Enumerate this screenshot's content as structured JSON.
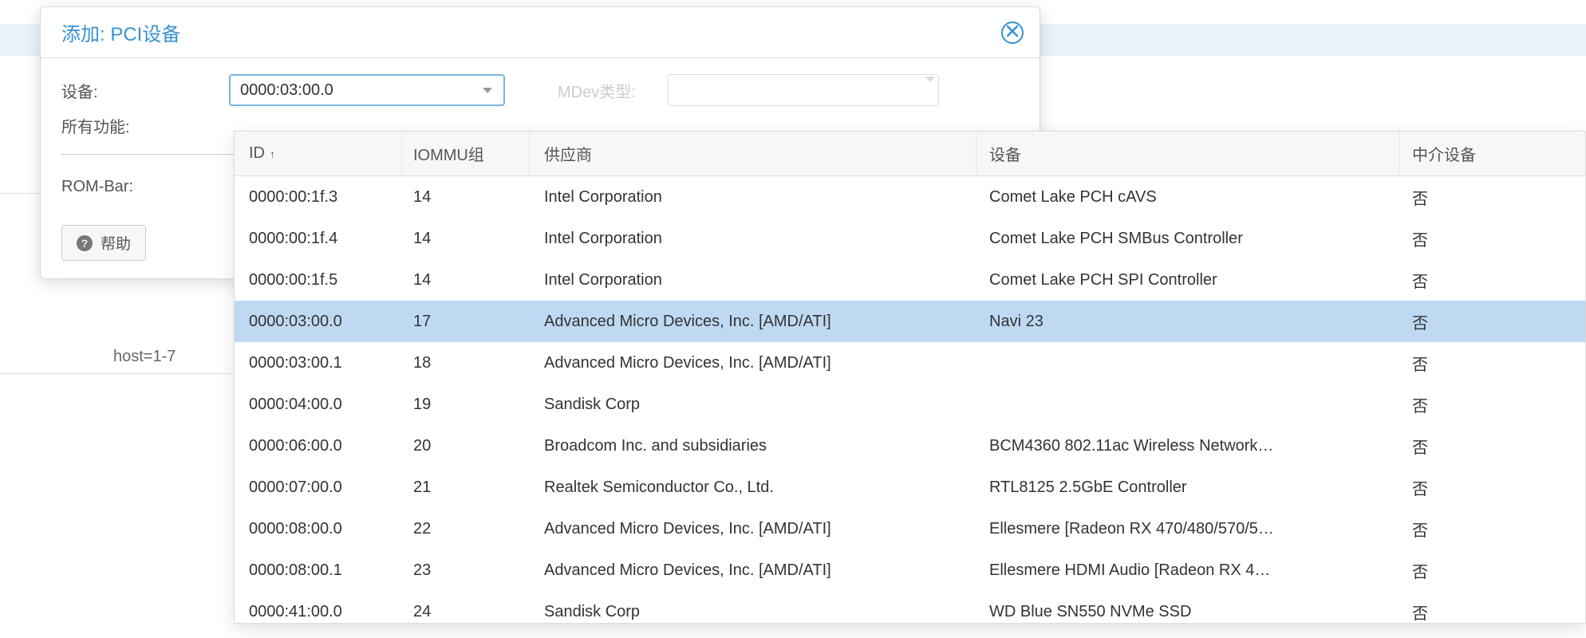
{
  "background": {
    "text1": "host=1-7"
  },
  "dialog": {
    "title": "添加: PCI设备",
    "form": {
      "device_label": "设备:",
      "device_value": "0000:03:00.0",
      "mdev_label": "MDev类型:",
      "all_functions_label": "所有功能:",
      "rom_bar_label": "ROM-Bar:"
    },
    "help_label": "帮助"
  },
  "grid": {
    "headers": {
      "id": "ID",
      "iommu": "IOMMU组",
      "vendor": "供应商",
      "device": "设备",
      "mdev": "中介设备"
    },
    "rows": [
      {
        "id": "0000:00:1f.3",
        "iommu": "14",
        "vendor": "Intel Corporation",
        "device": "Comet Lake PCH cAVS",
        "mdev": "否",
        "selected": false
      },
      {
        "id": "0000:00:1f.4",
        "iommu": "14",
        "vendor": "Intel Corporation",
        "device": "Comet Lake PCH SMBus Controller",
        "mdev": "否",
        "selected": false
      },
      {
        "id": "0000:00:1f.5",
        "iommu": "14",
        "vendor": "Intel Corporation",
        "device": "Comet Lake PCH SPI Controller",
        "mdev": "否",
        "selected": false
      },
      {
        "id": "0000:03:00.0",
        "iommu": "17",
        "vendor": "Advanced Micro Devices, Inc. [AMD/ATI]",
        "device": "Navi 23",
        "mdev": "否",
        "selected": true
      },
      {
        "id": "0000:03:00.1",
        "iommu": "18",
        "vendor": "Advanced Micro Devices, Inc. [AMD/ATI]",
        "device": "",
        "mdev": "否",
        "selected": false
      },
      {
        "id": "0000:04:00.0",
        "iommu": "19",
        "vendor": "Sandisk Corp",
        "device": "",
        "mdev": "否",
        "selected": false
      },
      {
        "id": "0000:06:00.0",
        "iommu": "20",
        "vendor": "Broadcom Inc. and subsidiaries",
        "device": "BCM4360 802.11ac Wireless Network…",
        "mdev": "否",
        "selected": false
      },
      {
        "id": "0000:07:00.0",
        "iommu": "21",
        "vendor": "Realtek Semiconductor Co., Ltd.",
        "device": "RTL8125 2.5GbE Controller",
        "mdev": "否",
        "selected": false
      },
      {
        "id": "0000:08:00.0",
        "iommu": "22",
        "vendor": "Advanced Micro Devices, Inc. [AMD/ATI]",
        "device": "Ellesmere [Radeon RX 470/480/570/5…",
        "mdev": "否",
        "selected": false
      },
      {
        "id": "0000:08:00.1",
        "iommu": "23",
        "vendor": "Advanced Micro Devices, Inc. [AMD/ATI]",
        "device": "Ellesmere HDMI Audio [Radeon RX 4…",
        "mdev": "否",
        "selected": false
      },
      {
        "id": "0000:41:00.0",
        "iommu": "24",
        "vendor": "Sandisk Corp",
        "device": "WD Blue SN550 NVMe SSD",
        "mdev": "否",
        "selected": false
      }
    ]
  }
}
